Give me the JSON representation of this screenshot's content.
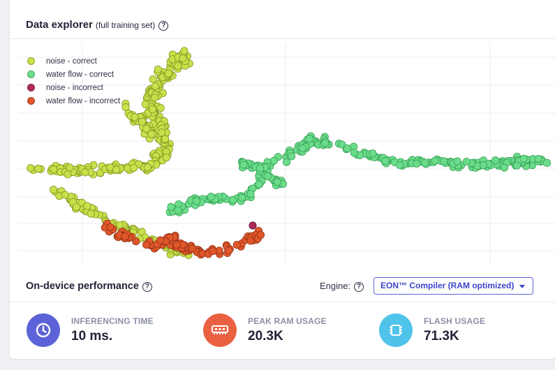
{
  "explorer": {
    "title": "Data explorer",
    "subtitle": "(full training set)",
    "help": "?"
  },
  "colors": {
    "noise_correct": "#c8e04a",
    "water_correct": "#6bdc8a",
    "noise_incorrect": "#b02a5a",
    "water_incorrect": "#e0572b",
    "accent": "#5c63d8",
    "time_icon_bg": "#5c63d8",
    "ram_icon_bg": "#ea6142",
    "flash_icon_bg": "#4fc3ea"
  },
  "chart_data": {
    "type": "scatter",
    "grid": "on",
    "legend_position": "top-left",
    "series": [
      {
        "name": "noise - correct",
        "color": "#c8e04a"
      },
      {
        "name": "water flow - correct",
        "color": "#6bdc8a"
      },
      {
        "name": "noise - incorrect",
        "color": "#b02a5a"
      },
      {
        "name": "water flow - incorrect",
        "color": "#e0572b"
      }
    ]
  },
  "performance": {
    "title": "On-device performance",
    "help": "?",
    "engine_label": "Engine:",
    "engine_value": "EON™ Compiler (RAM optimized)",
    "metrics": [
      {
        "label": "INFERENCING TIME",
        "value": "10 ms.",
        "icon": "clock-icon"
      },
      {
        "label": "PEAK RAM USAGE",
        "value": "20.3K",
        "icon": "ram-chip-icon"
      },
      {
        "label": "FLASH USAGE",
        "value": "71.3K",
        "icon": "flash-chip-icon"
      }
    ]
  }
}
